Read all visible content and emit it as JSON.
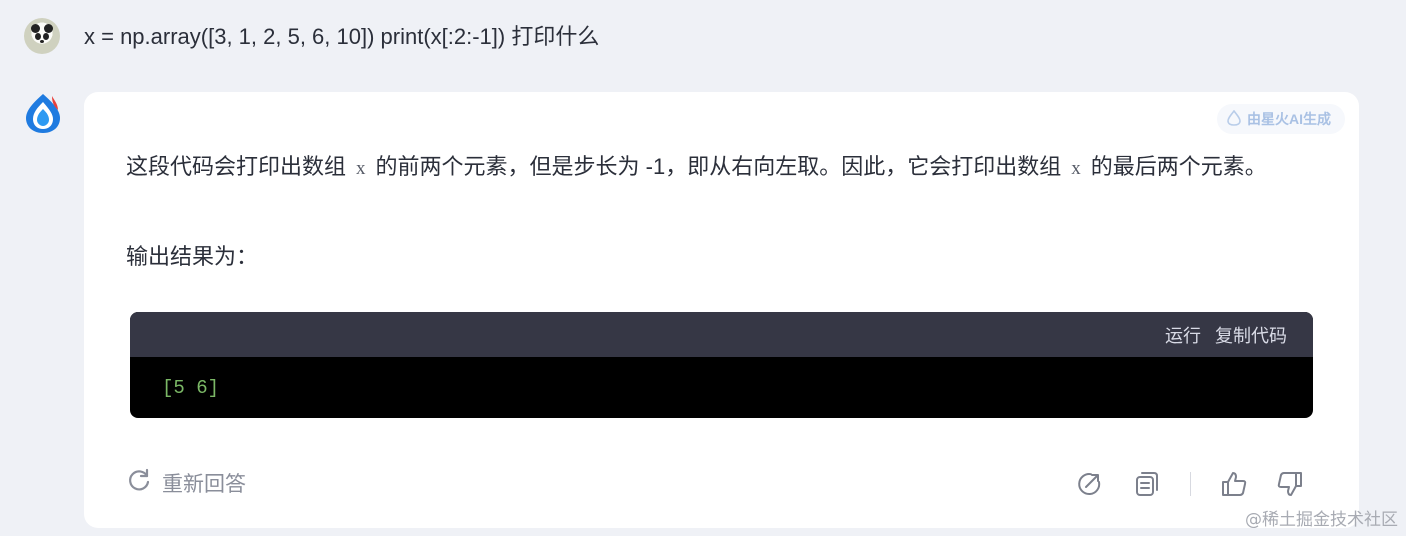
{
  "user": {
    "question": "x = np.array([3, 1, 2, 5, 6, 10]) print(x[:2:-1]) 打印什么"
  },
  "answer": {
    "badge": "由星火AI生成",
    "line1_part1": "这段代码会打印出数组",
    "code_var1": "x",
    "line1_part2": "的前两个元素，但是步长为 -1，即从右向左取。因此，它会打印出数组",
    "code_var2": "x",
    "line1_part3": "的最后两个元素。",
    "output_label": "输出结果为：",
    "code_block": {
      "run_label": "运行",
      "copy_label": "复制代码",
      "content": "[5 6]"
    },
    "regenerate_label": "重新回答"
  },
  "colors": {
    "page_bg": "#eff1f6",
    "card_bg": "#ffffff",
    "code_header_bg": "#363745",
    "code_bg": "#000000",
    "code_text": "#7bb866",
    "badge_text": "#a9c1e4"
  },
  "icons": {
    "user_avatar": "panda-avatar",
    "ai_avatar": "spark-logo-icon",
    "regenerate": "refresh-icon",
    "share": "share-icon",
    "copy": "copy-icon",
    "like": "thumbs-up-icon",
    "dislike": "thumbs-down-icon"
  },
  "watermark": "@稀土掘金技术社区"
}
